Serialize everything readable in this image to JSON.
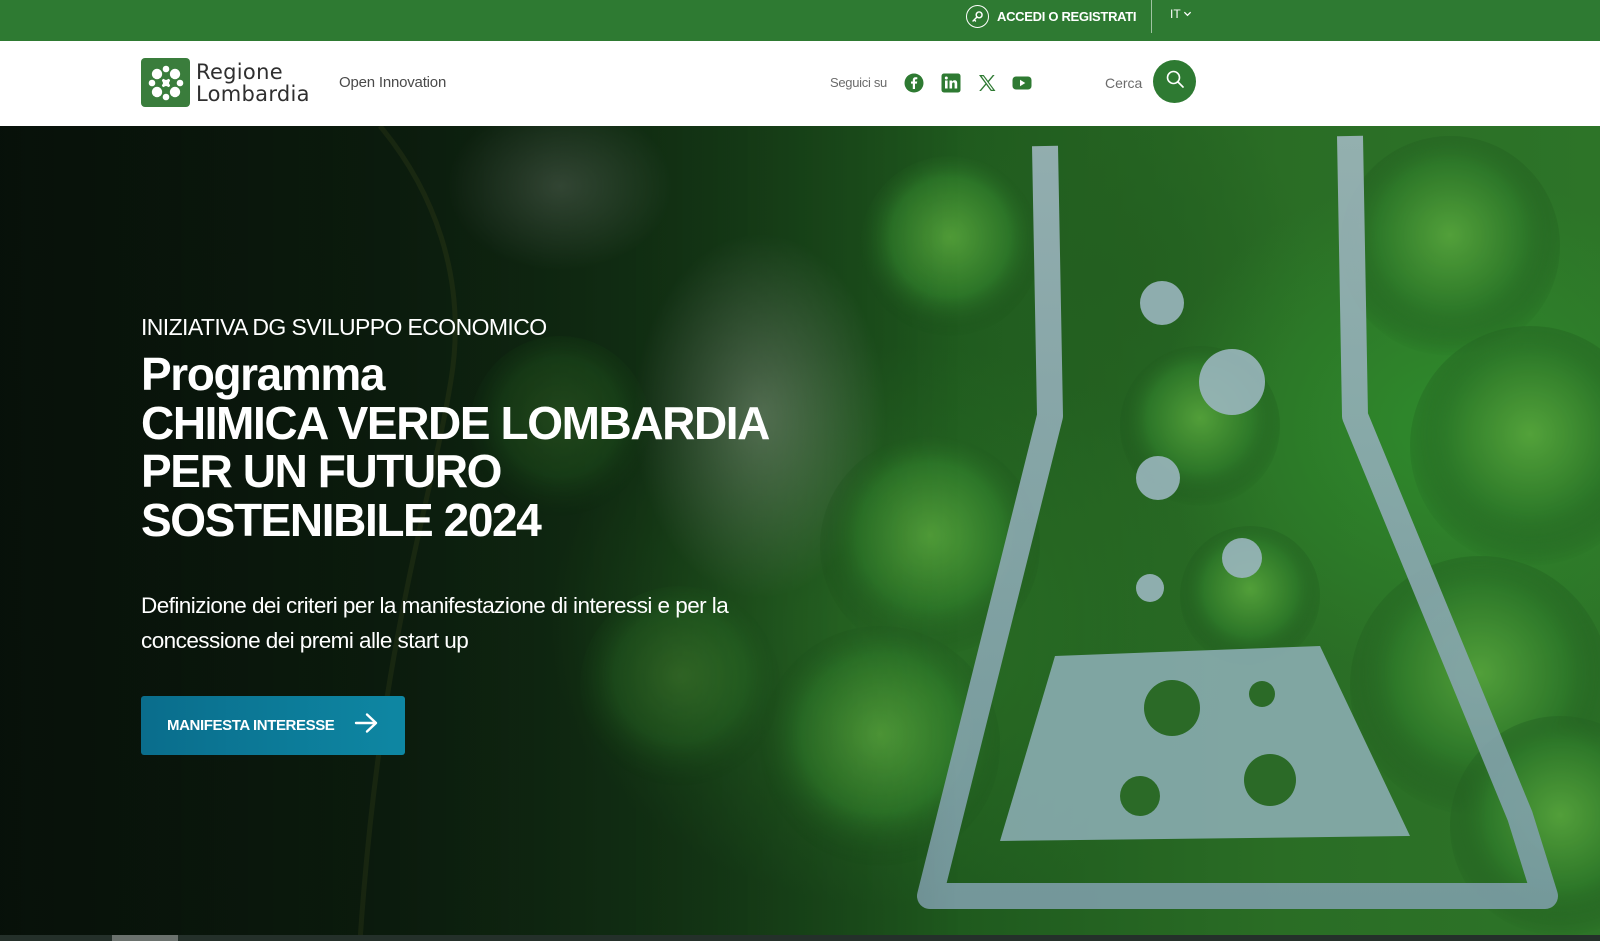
{
  "topbar": {
    "login_label": "ACCEDI O REGISTRATI",
    "login_icon": "key-icon",
    "language": "IT",
    "language_icon": "chevron-down-icon"
  },
  "header": {
    "logo_line1": "Regione",
    "logo_line2": "Lombardia",
    "subsite": "Open Innovation",
    "follow_label": "Seguici su",
    "social": [
      "facebook-icon",
      "linkedin-icon",
      "x-icon",
      "youtube-icon"
    ],
    "search_label": "Cerca",
    "search_icon": "search-icon"
  },
  "hero": {
    "eyebrow": "INIZIATIVA DG SVILUPPO ECONOMICO",
    "title_lines": [
      "Programma",
      "CHIMICA VERDE LOMBARDIA",
      "PER UN FUTURO",
      "SOSTENIBILE 2024"
    ],
    "description": "Definizione dei criteri per la manifestazione di interessi e per la concessione dei premi alle start up",
    "cta_label": "MANIFESTA INTERESSE",
    "cta_icon": "arrow-right-icon"
  },
  "colors": {
    "brand_green": "#2e7a32",
    "cta_blue": "#0b7592",
    "text_dark": "#2f2f2f"
  }
}
